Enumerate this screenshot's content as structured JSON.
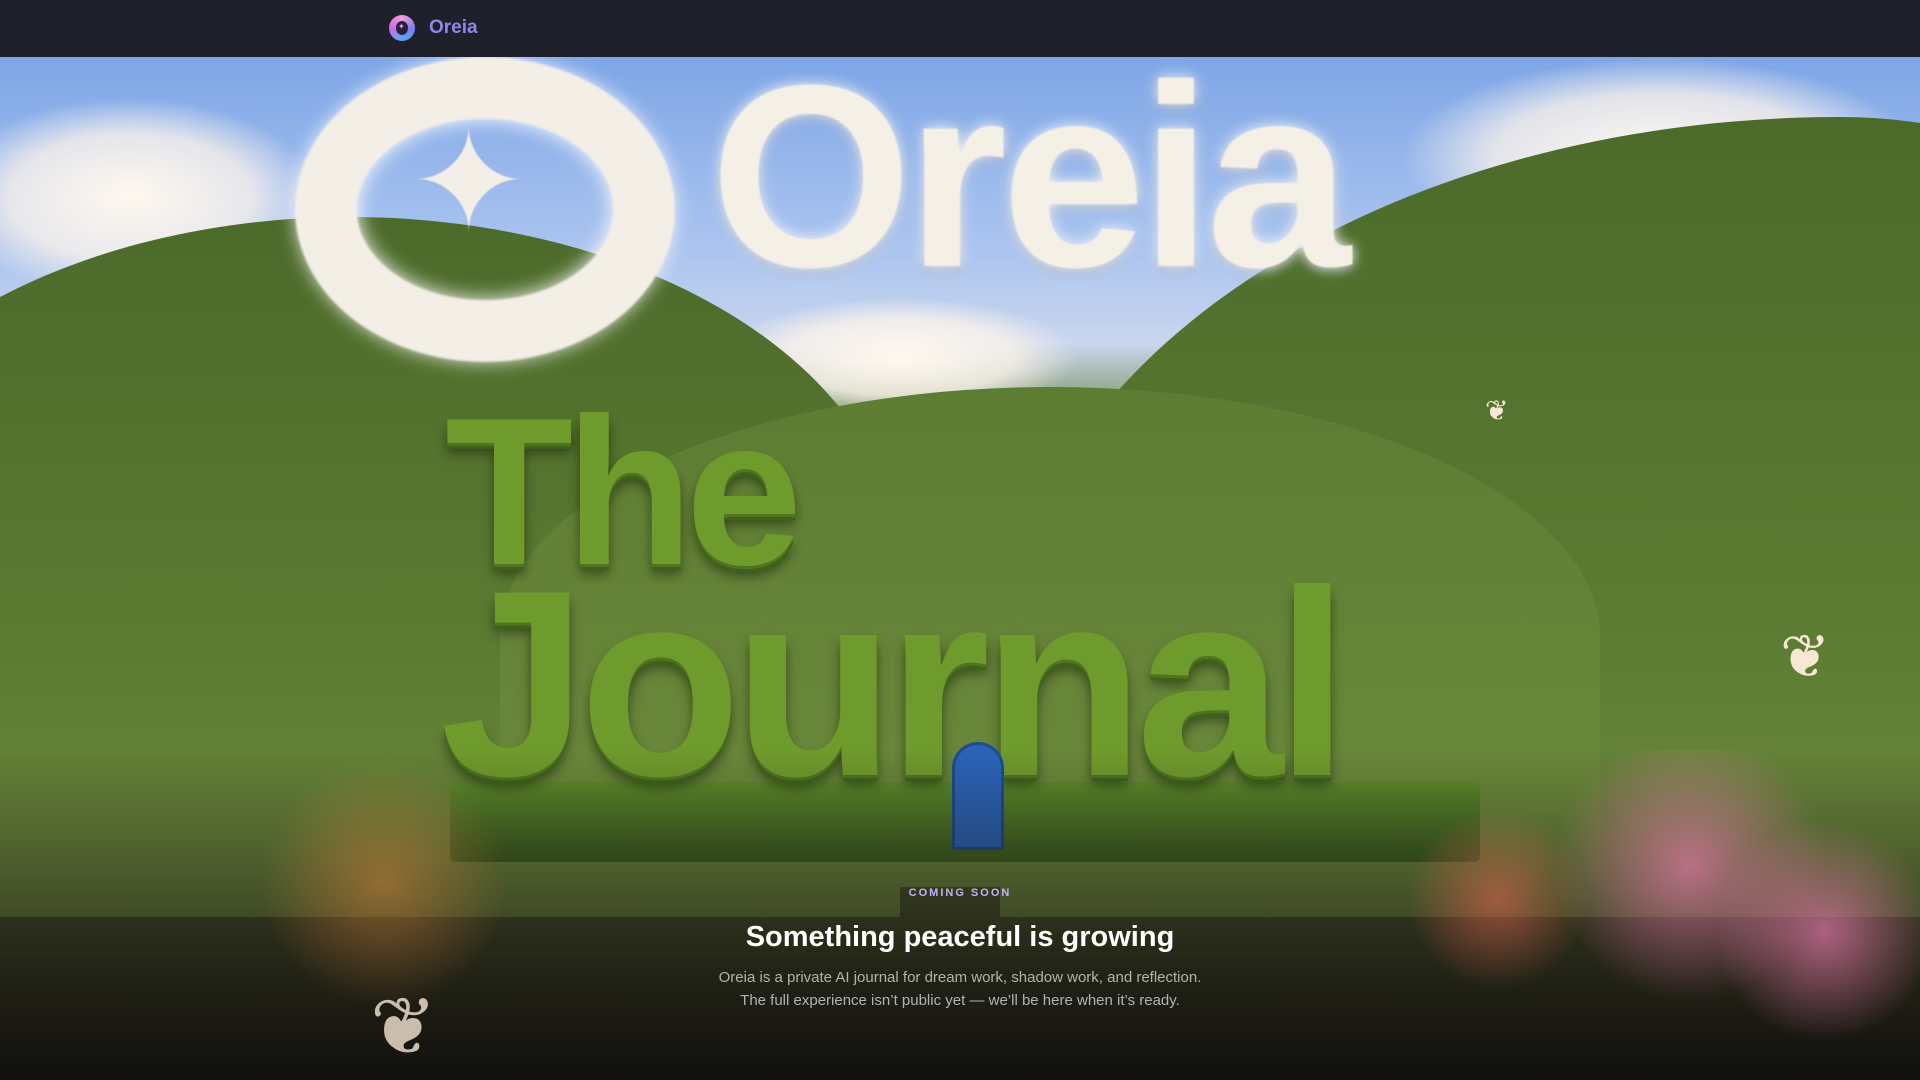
{
  "header": {
    "brand": "Oreia",
    "logo_icon": "oreia-ring-logo"
  },
  "hero": {
    "sky_wordmark": "Oreia",
    "hedge_line1": "The",
    "hedge_line2": "Journal"
  },
  "content": {
    "eyebrow": "COMING SOON",
    "headline": "Something peaceful is growing",
    "description_line1": "Oreia is a private AI journal for dream work, shadow work, and reflection.",
    "description_line2": "The full experience isn’t public yet — we’ll be here when it’s ready."
  }
}
